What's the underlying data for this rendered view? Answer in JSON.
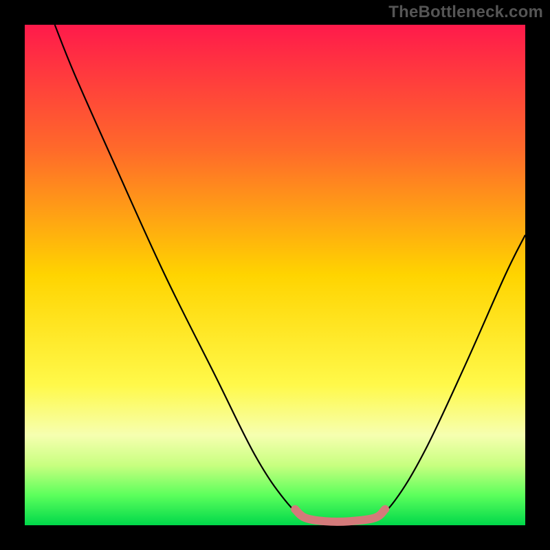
{
  "watermark": "TheBottleneck.com",
  "chart_data": {
    "type": "line",
    "title": "",
    "xlabel": "",
    "ylabel": "",
    "xlim": [
      0,
      100
    ],
    "ylim": [
      0,
      100
    ],
    "gradient_stops": [
      {
        "offset": 0,
        "color": "#ff1a4b"
      },
      {
        "offset": 25,
        "color": "#ff6a2a"
      },
      {
        "offset": 50,
        "color": "#ffd400"
      },
      {
        "offset": 72,
        "color": "#fff94a"
      },
      {
        "offset": 82,
        "color": "#f6ffb0"
      },
      {
        "offset": 88,
        "color": "#c8ff80"
      },
      {
        "offset": 94,
        "color": "#5cff5c"
      },
      {
        "offset": 100,
        "color": "#00d84a"
      }
    ],
    "series": [
      {
        "name": "bottleneck-curve",
        "color": "#000000",
        "points": [
          {
            "x": 6,
            "y": 100
          },
          {
            "x": 10,
            "y": 90
          },
          {
            "x": 18,
            "y": 72
          },
          {
            "x": 28,
            "y": 50
          },
          {
            "x": 38,
            "y": 30
          },
          {
            "x": 46,
            "y": 14
          },
          {
            "x": 52,
            "y": 5
          },
          {
            "x": 56,
            "y": 1.5
          },
          {
            "x": 60,
            "y": 0.8
          },
          {
            "x": 65,
            "y": 0.8
          },
          {
            "x": 70,
            "y": 1.5
          },
          {
            "x": 74,
            "y": 5
          },
          {
            "x": 80,
            "y": 15
          },
          {
            "x": 88,
            "y": 32
          },
          {
            "x": 96,
            "y": 50
          },
          {
            "x": 100,
            "y": 58
          }
        ]
      }
    ],
    "highlight_segment": {
      "name": "optimal-zone",
      "color": "#d47a7a",
      "points": [
        {
          "x": 54,
          "y": 3.2
        },
        {
          "x": 56,
          "y": 1.5
        },
        {
          "x": 60,
          "y": 0.8
        },
        {
          "x": 65,
          "y": 0.8
        },
        {
          "x": 70,
          "y": 1.5
        },
        {
          "x": 72,
          "y": 3.2
        }
      ]
    }
  }
}
